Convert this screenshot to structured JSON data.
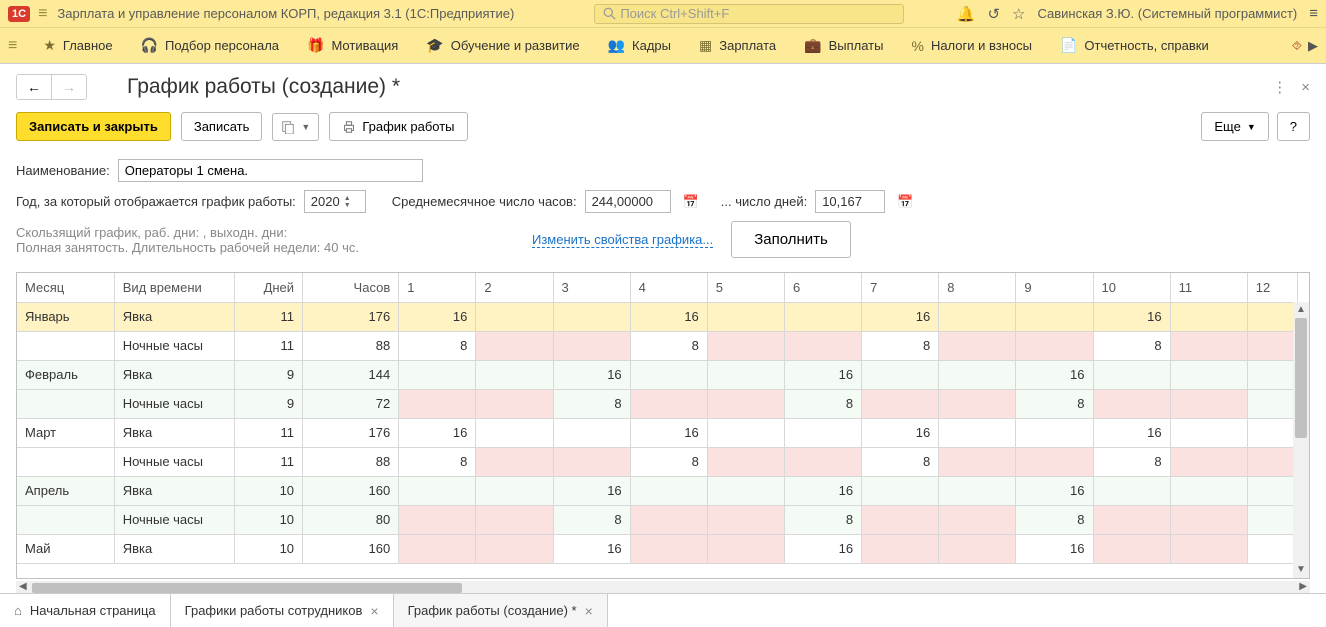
{
  "titlebar": {
    "app_title": "Зарплата и управление персоналом КОРП, редакция 3.1  (1С:Предприятие)",
    "search_placeholder": "Поиск Ctrl+Shift+F",
    "user": "Савинская З.Ю. (Системный программист)"
  },
  "mainnav": [
    {
      "label": "Главное",
      "icon": "star"
    },
    {
      "label": "Подбор персонала",
      "icon": "headset"
    },
    {
      "label": "Мотивация",
      "icon": "gift"
    },
    {
      "label": "Обучение и развитие",
      "icon": "grad"
    },
    {
      "label": "Кадры",
      "icon": "people"
    },
    {
      "label": "Зарплата",
      "icon": "table"
    },
    {
      "label": "Выплаты",
      "icon": "wallet"
    },
    {
      "label": "Налоги и взносы",
      "icon": "percent"
    },
    {
      "label": "Отчетность, справки",
      "icon": "doc"
    }
  ],
  "page": {
    "title": "График работы (создание) *"
  },
  "toolbar": {
    "write_close": "Записать и закрыть",
    "write": "Записать",
    "print": "График работы",
    "more": "Еще",
    "help": "?"
  },
  "form": {
    "name_label": "Наименование:",
    "name_value": "Операторы 1 смена.",
    "year_label": "Год, за который отображается график работы:",
    "year_value": "2020",
    "avg_hours_label": "Среднемесячное число часов:",
    "avg_hours_value": "244,00000",
    "days_label": "... число дней:",
    "days_value": "10,167",
    "info_line1": "Скользящий график, раб. дни: , выходн. дни:",
    "info_line2": "Полная занятость. Длительность рабочей недели: 40 чс.",
    "change_link": "Изменить свойства графика...",
    "fill_btn": "Заполнить"
  },
  "table": {
    "headers": [
      "Месяц",
      "Вид времени",
      "Дней",
      "Часов",
      "1",
      "2",
      "3",
      "4",
      "5",
      "6",
      "7",
      "8",
      "9",
      "10",
      "11",
      "12"
    ],
    "rows": [
      {
        "month": "Январь",
        "type": "Явка",
        "days": "11",
        "hours": "176",
        "sel": true,
        "cells": [
          "16",
          "",
          "",
          "16",
          "",
          "",
          "16",
          "",
          "",
          "16",
          "",
          ""
        ],
        "pink": [
          0,
          0,
          0,
          0,
          0,
          0,
          0,
          0,
          0,
          0,
          0,
          0
        ]
      },
      {
        "month": "",
        "type": "Ночные часы",
        "days": "11",
        "hours": "88",
        "cells": [
          "8",
          "",
          "",
          "8",
          "",
          "",
          "8",
          "",
          "",
          "8",
          "",
          ""
        ],
        "pink": [
          0,
          1,
          1,
          0,
          1,
          1,
          0,
          1,
          1,
          0,
          1,
          1
        ]
      },
      {
        "month": "Февраль",
        "type": "Явка",
        "days": "9",
        "hours": "144",
        "even": true,
        "cells": [
          "",
          "",
          "16",
          "",
          "",
          "16",
          "",
          "",
          "16",
          "",
          "",
          ""
        ],
        "pink": [
          0,
          0,
          0,
          0,
          0,
          0,
          0,
          0,
          0,
          0,
          0,
          0
        ]
      },
      {
        "month": "",
        "type": "Ночные часы",
        "days": "9",
        "hours": "72",
        "even": true,
        "cells": [
          "",
          "",
          "8",
          "",
          "",
          "8",
          "",
          "",
          "8",
          "",
          "",
          ""
        ],
        "pink": [
          1,
          1,
          0,
          1,
          1,
          0,
          1,
          1,
          0,
          1,
          1,
          0
        ]
      },
      {
        "month": "Март",
        "type": "Явка",
        "days": "11",
        "hours": "176",
        "cells": [
          "16",
          "",
          "",
          "16",
          "",
          "",
          "16",
          "",
          "",
          "16",
          "",
          ""
        ],
        "pink": [
          0,
          0,
          0,
          0,
          0,
          0,
          0,
          0,
          0,
          0,
          0,
          0
        ]
      },
      {
        "month": "",
        "type": "Ночные часы",
        "days": "11",
        "hours": "88",
        "cells": [
          "8",
          "",
          "",
          "8",
          "",
          "",
          "8",
          "",
          "",
          "8",
          "",
          ""
        ],
        "pink": [
          0,
          1,
          1,
          0,
          1,
          1,
          0,
          1,
          1,
          0,
          1,
          1
        ]
      },
      {
        "month": "Апрель",
        "type": "Явка",
        "days": "10",
        "hours": "160",
        "even": true,
        "cells": [
          "",
          "",
          "16",
          "",
          "",
          "16",
          "",
          "",
          "16",
          "",
          "",
          ""
        ],
        "pink": [
          0,
          0,
          0,
          0,
          0,
          0,
          0,
          0,
          0,
          0,
          0,
          0
        ]
      },
      {
        "month": "",
        "type": "Ночные часы",
        "days": "10",
        "hours": "80",
        "even": true,
        "cells": [
          "",
          "",
          "8",
          "",
          "",
          "8",
          "",
          "",
          "8",
          "",
          "",
          ""
        ],
        "pink": [
          1,
          1,
          0,
          1,
          1,
          0,
          1,
          1,
          0,
          1,
          1,
          0
        ]
      },
      {
        "month": "Май",
        "type": "Явка",
        "days": "10",
        "hours": "160",
        "cells": [
          "",
          "",
          "16",
          "",
          "",
          "16",
          "",
          "",
          "16",
          "",
          "",
          ""
        ],
        "pink": [
          1,
          1,
          0,
          1,
          1,
          0,
          1,
          1,
          0,
          1,
          1,
          0
        ]
      }
    ]
  },
  "tabs": [
    {
      "label": "Начальная страница",
      "home": true
    },
    {
      "label": "Графики работы сотрудников",
      "close": true
    },
    {
      "label": "График работы (создание) *",
      "close": true,
      "active": true
    }
  ]
}
